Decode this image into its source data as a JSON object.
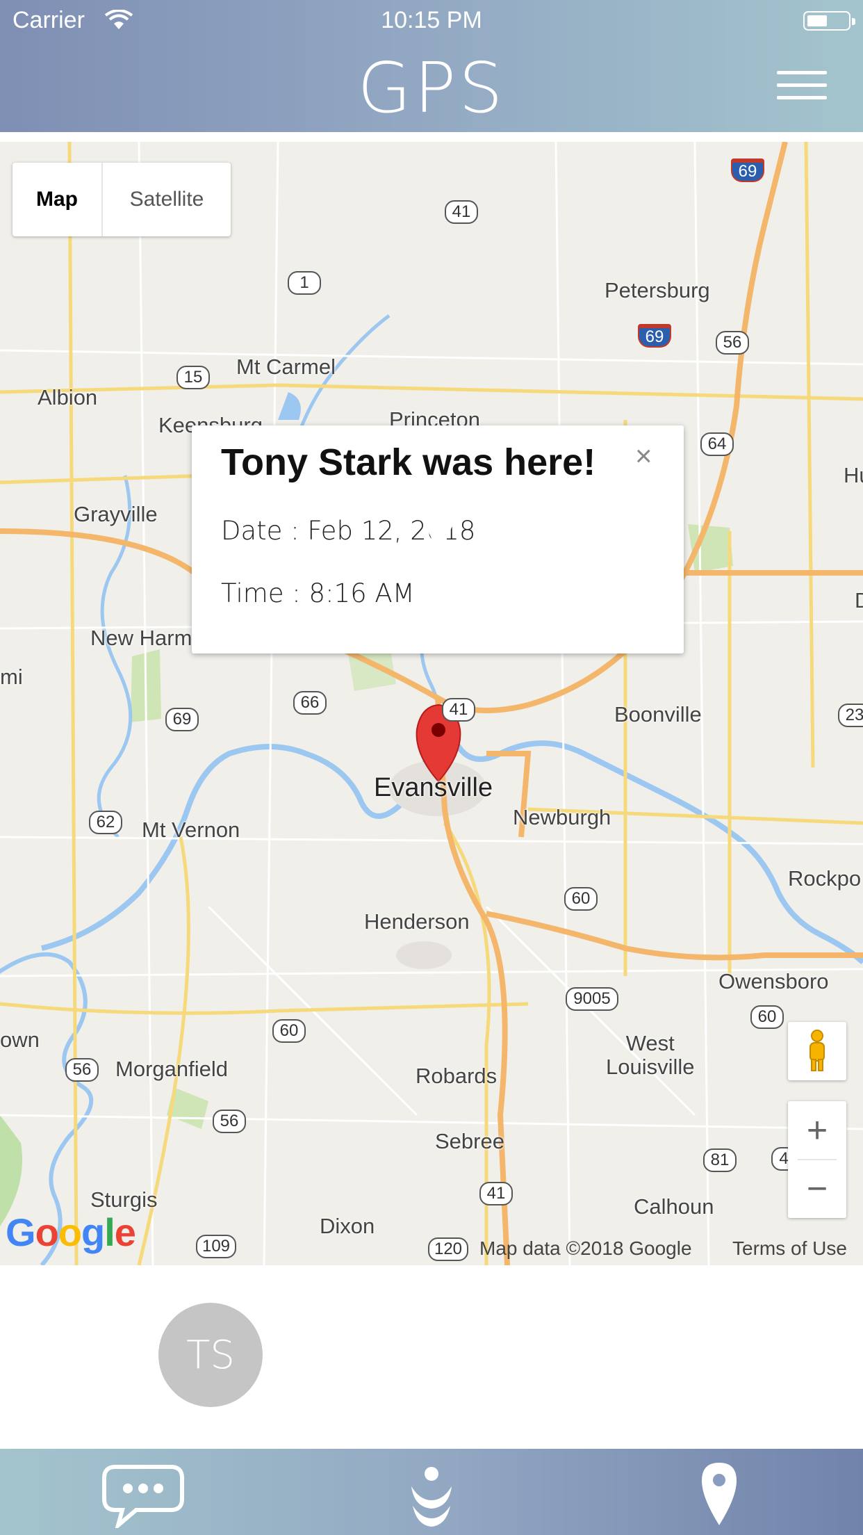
{
  "status_bar": {
    "carrier": "Carrier",
    "time": "10:15 PM"
  },
  "header": {
    "title": "GPS"
  },
  "map_type": {
    "map_label": "Map",
    "satellite_label": "Satellite",
    "selected": "Map"
  },
  "info_window": {
    "title": "Tony Stark was here!",
    "close": "×",
    "date": "Date : Feb 12, 2018",
    "time": "Time : 8:16 AM"
  },
  "places": {
    "petersburg": "Petersburg",
    "mt_carmel": "Mt Carmel",
    "albion": "Albion",
    "keensburg": "Keensburg",
    "princeton": "Princeton",
    "grayville": "Grayville",
    "new_harmony": "New Harm",
    "mi": "mi",
    "boonville": "Boonville",
    "evansville": "Evansville",
    "newburgh": "Newburgh",
    "mt_vernon": "Mt Vernon",
    "rockport": "Rockpo",
    "henderson": "Henderson",
    "owensboro": "Owensboro",
    "town": "own",
    "morganfield": "Morganfield",
    "west_louisville": "West\nLouisville",
    "robards": "Robards",
    "sebree": "Sebree",
    "sturgis": "Sturgis",
    "dixon": "Dixon",
    "calhoun": "Calhoun",
    "hu": "Hu",
    "d": "D"
  },
  "routes": {
    "r41a": "41",
    "r1": "1",
    "r15": "15",
    "r56a": "56",
    "r64": "64",
    "r69a": "69",
    "r66": "66",
    "r41b": "41",
    "r62": "62",
    "r60a": "60",
    "r9005": "9005",
    "r60b": "60",
    "r56b": "56",
    "r56c": "56",
    "r60c": "60",
    "r81": "81",
    "r41c": "41",
    "r109": "109",
    "r120": "120",
    "r23": "23",
    "r4": "4",
    "i69a": "69",
    "i69b": "69"
  },
  "map_footer": {
    "logo": "Google",
    "attribution": "Map data ©2018 Google",
    "terms": "Terms of Use"
  },
  "zoom": {
    "in": "+",
    "out": "−"
  },
  "avatar": {
    "initials": "TS"
  },
  "tabs": [
    "chat-icon",
    "activity-icon",
    "location-pin-icon"
  ],
  "colors": {
    "header_start": "#7f8fb4",
    "header_end": "#a3c4cd",
    "marker": "#e53935"
  }
}
